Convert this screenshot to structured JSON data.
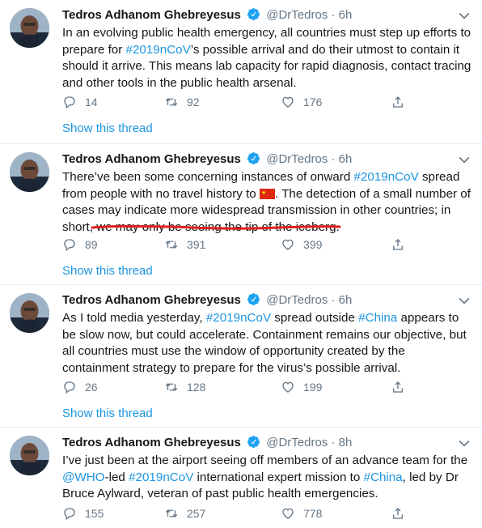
{
  "tweets": [
    {
      "name": "Tedros Adhanom Ghebreyesus",
      "handle": "@DrTedros",
      "dot": "·",
      "time": "6h",
      "text_parts": [
        {
          "t": "In an evolving public health emergency, all countries must step up efforts to prepare for "
        },
        {
          "t": "#2019nCoV",
          "link": true
        },
        {
          "t": "’s possible arrival and do their utmost to contain it should it arrive. This means lab capacity for rapid diagnosis, contact tracing and other tools in the public health arsenal."
        }
      ],
      "replies": "14",
      "retweets": "92",
      "likes": "176",
      "show_thread": "Show this thread"
    },
    {
      "name": "Tedros Adhanom Ghebreyesus",
      "handle": "@DrTedros",
      "dot": "·",
      "time": "6h",
      "text_parts": [
        {
          "t": "There’ve been some concerning instances of onward "
        },
        {
          "t": "#2019nCoV",
          "link": true
        },
        {
          "t": " spread from people with no travel history to "
        },
        {
          "flag": "china-flag"
        },
        {
          "t": ". The detection of a small number of cases may indicate more widespread transmission in other countries; in short, we may only be seeing the tip of the iceberg."
        }
      ],
      "replies": "89",
      "retweets": "391",
      "likes": "399",
      "show_thread": "Show this thread"
    },
    {
      "name": "Tedros Adhanom Ghebreyesus",
      "handle": "@DrTedros",
      "dot": "·",
      "time": "6h",
      "text_parts": [
        {
          "t": "As I told media yesterday, "
        },
        {
          "t": "#2019nCoV",
          "link": true
        },
        {
          "t": " spread outside "
        },
        {
          "t": "#China",
          "link": true
        },
        {
          "t": " appears to be slow now, but could accelerate. Containment remains our objective, but all countries must use the window of opportunity created by the containment strategy to prepare for the virus’s possible arrival."
        }
      ],
      "replies": "26",
      "retweets": "128",
      "likes": "199",
      "show_thread": "Show this thread"
    },
    {
      "name": "Tedros Adhanom Ghebreyesus",
      "handle": "@DrTedros",
      "dot": "·",
      "time": "8h",
      "text_parts": [
        {
          "t": "I’ve just been at the airport seeing off members of an advance team for the "
        },
        {
          "t": "@WHO",
          "link": true
        },
        {
          "t": "-led "
        },
        {
          "t": "#2019nCoV",
          "link": true
        },
        {
          "t": " international expert mission to "
        },
        {
          "t": "#China",
          "link": true
        },
        {
          "t": ", led by Dr Bruce Aylward, veteran of past public health emergencies."
        }
      ],
      "replies": "155",
      "retweets": "257",
      "likes": "778",
      "show_thread": ""
    }
  ],
  "colors": {
    "link": "#1b95e0",
    "secondary_text": "#657786",
    "verified_badge": "#1da1f2",
    "annotation_underline": "#e0201f",
    "divider": "#e6ecf0"
  },
  "icons": [
    "verified-badge-icon",
    "chevron-down-icon",
    "reply-icon",
    "retweet-icon",
    "like-icon",
    "share-icon"
  ]
}
